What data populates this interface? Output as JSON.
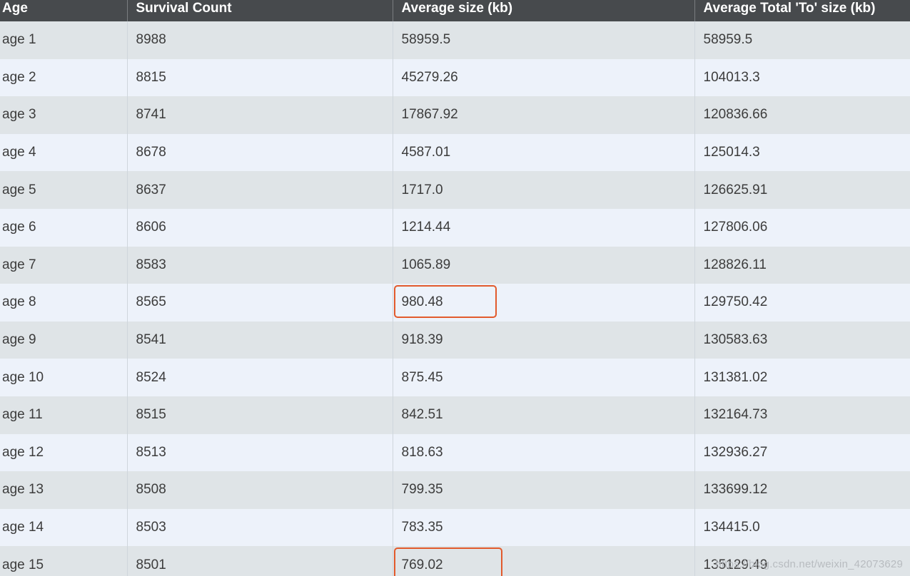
{
  "table": {
    "headers": [
      "Age",
      "Survival Count",
      "Average size (kb)",
      "Average Total 'To' size (kb)"
    ],
    "rows": [
      {
        "age": "age 1",
        "count": "8988",
        "avg": "58959.5",
        "total": "58959.5"
      },
      {
        "age": "age 2",
        "count": "8815",
        "avg": "45279.26",
        "total": "104013.3"
      },
      {
        "age": "age 3",
        "count": "8741",
        "avg": "17867.92",
        "total": "120836.66"
      },
      {
        "age": "age 4",
        "count": "8678",
        "avg": "4587.01",
        "total": "125014.3"
      },
      {
        "age": "age 5",
        "count": "8637",
        "avg": "1717.0",
        "total": "126625.91"
      },
      {
        "age": "age 6",
        "count": "8606",
        "avg": "1214.44",
        "total": "127806.06"
      },
      {
        "age": "age 7",
        "count": "8583",
        "avg": "1065.89",
        "total": "128826.11"
      },
      {
        "age": "age 8",
        "count": "8565",
        "avg": "980.48",
        "total": "129750.42"
      },
      {
        "age": "age 9",
        "count": "8541",
        "avg": "918.39",
        "total": "130583.63"
      },
      {
        "age": "age 10",
        "count": "8524",
        "avg": "875.45",
        "total": "131381.02"
      },
      {
        "age": "age 11",
        "count": "8515",
        "avg": "842.51",
        "total": "132164.73"
      },
      {
        "age": "age 12",
        "count": "8513",
        "avg": "818.63",
        "total": "132936.27"
      },
      {
        "age": "age 13",
        "count": "8508",
        "avg": "799.35",
        "total": "133699.12"
      },
      {
        "age": "age 14",
        "count": "8503",
        "avg": "783.35",
        "total": "134415.0"
      },
      {
        "age": "age 15",
        "count": "8501",
        "avg": "769.02",
        "total": "135129.49"
      }
    ]
  },
  "watermark": "https://blog.csdn.net/weixin_42073629",
  "colors": {
    "header_bg": "#474a4d",
    "row_odd": "#dfe4e7",
    "row_even": "#edf2fa",
    "highlight": "#e25a2c"
  }
}
